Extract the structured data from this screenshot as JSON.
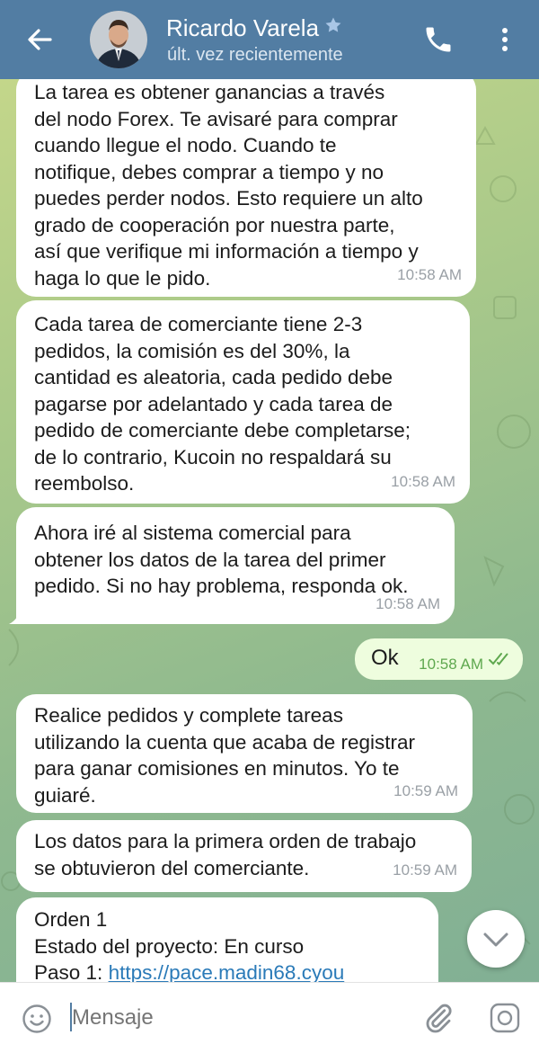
{
  "header": {
    "contact_name": "Ricardo Varela",
    "status": "últ. vez recientemente",
    "back_icon": "arrow-left-icon",
    "call_icon": "phone-icon",
    "menu_icon": "more-vertical-icon",
    "verified_icon": "star-icon",
    "color": "#527da3"
  },
  "messages": [
    {
      "direction": "in",
      "lines": [
        "La tarea es obtener ganancias a través",
        "del nodo Forex. Te avisaré para comprar",
        "cuando llegue el nodo. Cuando te",
        "notifique, debes comprar a tiempo y no",
        "puedes perder nodos. Esto requiere un alto",
        "grado de cooperación por nuestra parte,",
        "así que verifique mi información a tiempo y",
        "haga lo que le pido."
      ],
      "time": "10:58 AM"
    },
    {
      "direction": "in",
      "lines": [
        "Cada tarea de comerciante tiene 2-3",
        "pedidos, la comisión es del 30%, la",
        "cantidad es aleatoria, cada pedido debe",
        "pagarse por adelantado y cada tarea de",
        "pedido de comerciante debe completarse;",
        "de lo contrario, Kucoin no respaldará su",
        "reembolso."
      ],
      "time": "10:58 AM"
    },
    {
      "direction": "in",
      "lines": [
        "Ahora iré al sistema comercial para",
        "obtener los datos de la tarea del primer",
        "pedido. Si no hay problema, responda ok."
      ],
      "time": "10:58 AM"
    },
    {
      "direction": "out",
      "text": "Ok",
      "time": "10:58 AM",
      "read_icon": "double-check-icon"
    },
    {
      "direction": "in",
      "lines": [
        "Realice pedidos y complete tareas",
        "utilizando la cuenta que acaba de registrar",
        "para ganar comisiones en minutos. Yo te",
        "guiaré."
      ],
      "time": "10:59 AM"
    },
    {
      "direction": "in",
      "lines": [
        "Los datos para la primera orden de trabajo",
        "se obtuvieron del comerciante."
      ],
      "time": "10:59 AM"
    },
    {
      "direction": "in",
      "lines": [
        "Orden 1",
        "Estado del proyecto: En curso"
      ],
      "link_prefix": "Paso 1: ",
      "link_text": "https://pace.madin68.cyou"
    }
  ],
  "scroll_down_icon": "chevron-down-icon",
  "input": {
    "placeholder": "Mensaje",
    "emoji_icon": "smiley-icon",
    "attach_icon": "paperclip-icon",
    "camera_icon": "instagram-camera-icon"
  },
  "colors": {
    "incoming_bubble": "#ffffff",
    "outgoing_bubble": "#eefdde",
    "link": "#2a7ab8",
    "timestamp": "#9aa0a6",
    "outgoing_timestamp": "#5fa84f"
  }
}
